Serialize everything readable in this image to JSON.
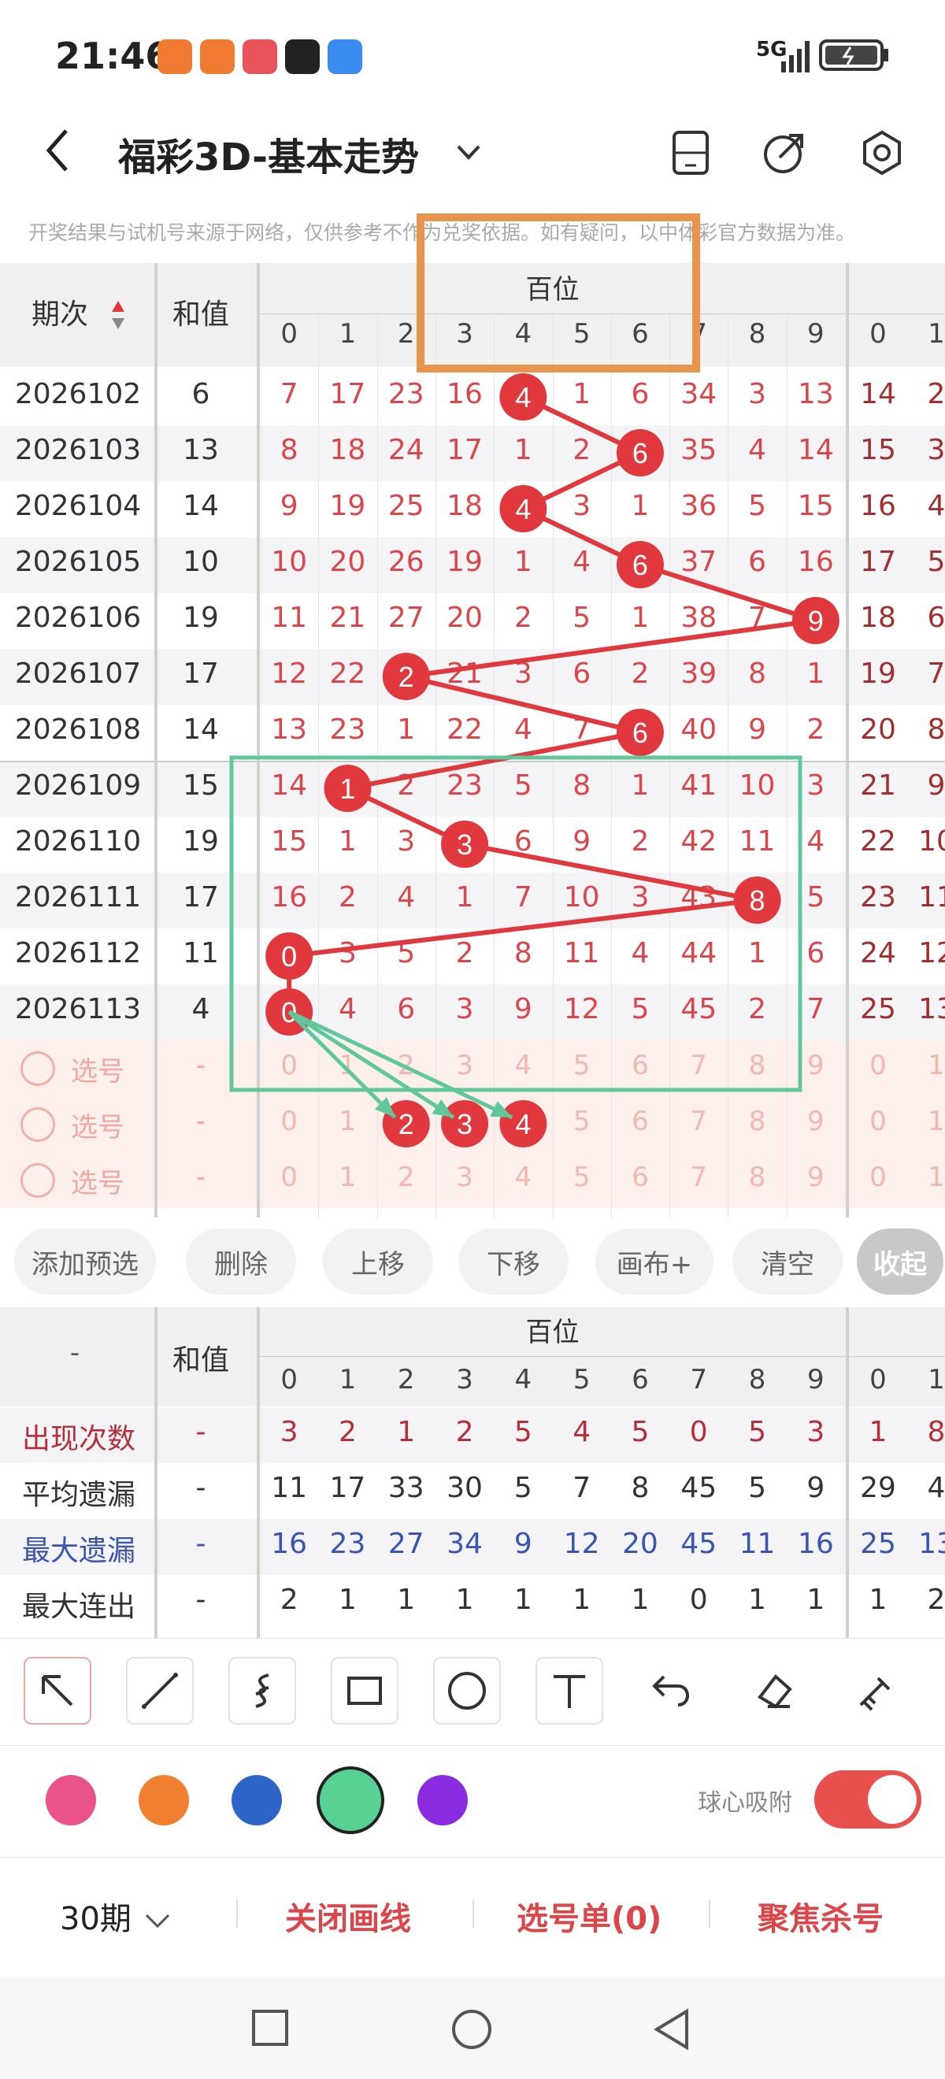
{
  "status": {
    "time": "21:46",
    "network": "5G"
  },
  "nav": {
    "title": "福彩3D-基本走势"
  },
  "notice": "开奖结果与试机号来源于网络，仅供参考不作为兑奖依据。如有疑问，以中体彩官方数据为准。",
  "table": {
    "col_period": "期次",
    "col_sum": "和值",
    "group_label": "百位",
    "digits": [
      "0",
      "1",
      "2",
      "3",
      "4",
      "5",
      "6",
      "7",
      "8",
      "9"
    ],
    "next_group_digits": [
      "0",
      "1"
    ],
    "rows": [
      {
        "period": "2026102",
        "sum": "6",
        "cells": [
          "7",
          "17",
          "23",
          "16",
          "4",
          "1",
          "6",
          "34",
          "3",
          "13"
        ],
        "hit": 4,
        "extra": [
          "14",
          "2"
        ]
      },
      {
        "period": "2026103",
        "sum": "13",
        "cells": [
          "8",
          "18",
          "24",
          "17",
          "1",
          "2",
          "6",
          "35",
          "4",
          "14"
        ],
        "hit": 6,
        "extra": [
          "15",
          "3"
        ]
      },
      {
        "period": "2026104",
        "sum": "14",
        "cells": [
          "9",
          "19",
          "25",
          "18",
          "4",
          "3",
          "1",
          "36",
          "5",
          "15"
        ],
        "hit": 4,
        "extra": [
          "16",
          "4"
        ]
      },
      {
        "period": "2026105",
        "sum": "10",
        "cells": [
          "10",
          "20",
          "26",
          "19",
          "1",
          "4",
          "6",
          "37",
          "6",
          "16"
        ],
        "hit": 6,
        "extra": [
          "17",
          "5"
        ]
      },
      {
        "period": "2026106",
        "sum": "19",
        "cells": [
          "11",
          "21",
          "27",
          "20",
          "2",
          "5",
          "1",
          "38",
          "7",
          "9"
        ],
        "hit": 9,
        "extra": [
          "18",
          "6"
        ]
      },
      {
        "period": "2026107",
        "sum": "17",
        "cells": [
          "12",
          "22",
          "2",
          "21",
          "3",
          "6",
          "2",
          "39",
          "8",
          "1"
        ],
        "hit": 2,
        "extra": [
          "19",
          "7"
        ]
      },
      {
        "period": "2026108",
        "sum": "14",
        "cells": [
          "13",
          "23",
          "1",
          "22",
          "4",
          "7",
          "6",
          "40",
          "9",
          "2"
        ],
        "hit": 6,
        "extra": [
          "20",
          "8"
        ]
      },
      {
        "period": "2026109",
        "sum": "15",
        "cells": [
          "14",
          "1",
          "2",
          "23",
          "5",
          "8",
          "1",
          "41",
          "10",
          "3"
        ],
        "hit": 1,
        "extra": [
          "21",
          "9"
        ]
      },
      {
        "period": "2026110",
        "sum": "19",
        "cells": [
          "15",
          "1",
          "3",
          "3",
          "6",
          "9",
          "2",
          "42",
          "11",
          "4"
        ],
        "hit": 3,
        "extra": [
          "22",
          "10"
        ]
      },
      {
        "period": "2026111",
        "sum": "17",
        "cells": [
          "16",
          "2",
          "4",
          "1",
          "7",
          "10",
          "3",
          "43",
          "8",
          "5"
        ],
        "hit": 8,
        "extra": [
          "23",
          "11"
        ]
      },
      {
        "period": "2026112",
        "sum": "11",
        "cells": [
          "0",
          "3",
          "5",
          "2",
          "8",
          "11",
          "4",
          "44",
          "1",
          "6"
        ],
        "hit": 0,
        "extra": [
          "24",
          "12"
        ]
      },
      {
        "period": "2026113",
        "sum": "4",
        "cells": [
          "0",
          "4",
          "6",
          "3",
          "9",
          "12",
          "5",
          "45",
          "2",
          "7"
        ],
        "hit": 0,
        "extra": [
          "25",
          "13"
        ]
      }
    ],
    "pick_rows": [
      {
        "label": "选号",
        "sum": "-",
        "selected": []
      },
      {
        "label": "选号",
        "sum": "-",
        "selected": [
          2,
          3,
          4
        ]
      },
      {
        "label": "选号",
        "sum": "-",
        "selected": []
      }
    ]
  },
  "actions": [
    "添加预选",
    "删除",
    "上移",
    "下移",
    "画布+",
    "清空",
    "收起"
  ],
  "stats": {
    "col_first": "-",
    "col_sum": "和值",
    "group_label": "百位",
    "rows": [
      {
        "label": "出现次数",
        "sum": "-",
        "color": "#b3303a",
        "cells": [
          "3",
          "2",
          "1",
          "2",
          "5",
          "4",
          "5",
          "0",
          "5",
          "3"
        ],
        "extra": [
          "1",
          "8"
        ]
      },
      {
        "label": "平均遗漏",
        "sum": "-",
        "color": "#333333",
        "cells": [
          "11",
          "17",
          "33",
          "30",
          "5",
          "7",
          "8",
          "45",
          "5",
          "9"
        ],
        "extra": [
          "29",
          "4"
        ]
      },
      {
        "label": "最大遗漏",
        "sum": "-",
        "color": "#3a55b0",
        "cells": [
          "16",
          "23",
          "27",
          "34",
          "9",
          "12",
          "20",
          "45",
          "11",
          "16"
        ],
        "extra": [
          "25",
          "13"
        ]
      },
      {
        "label": "最大连出",
        "sum": "-",
        "color": "#333333",
        "cells": [
          "2",
          "1",
          "1",
          "1",
          "1",
          "1",
          "1",
          "0",
          "1",
          "1"
        ],
        "extra": [
          "1",
          "2"
        ]
      }
    ]
  },
  "tools": [
    "arrow-tool",
    "line-tool",
    "curve-tool",
    "rect-tool",
    "circle-tool",
    "text-tool",
    "undo-tool",
    "eraser-tool",
    "brush-tool"
  ],
  "palette": [
    "#e9528a",
    "#f08030",
    "#2d64c8",
    "#58d195",
    "#8a2be2"
  ],
  "snap_label": "球心吸附",
  "footer": {
    "periods": "30期",
    "close_lines": "关闭画线",
    "ticket": "选号单(0)",
    "focus": "聚焦杀号"
  },
  "colors": {
    "red": "#e0383c",
    "text_red": "#d9474b",
    "green": "#5fc79a",
    "orange": "#e8944a"
  }
}
